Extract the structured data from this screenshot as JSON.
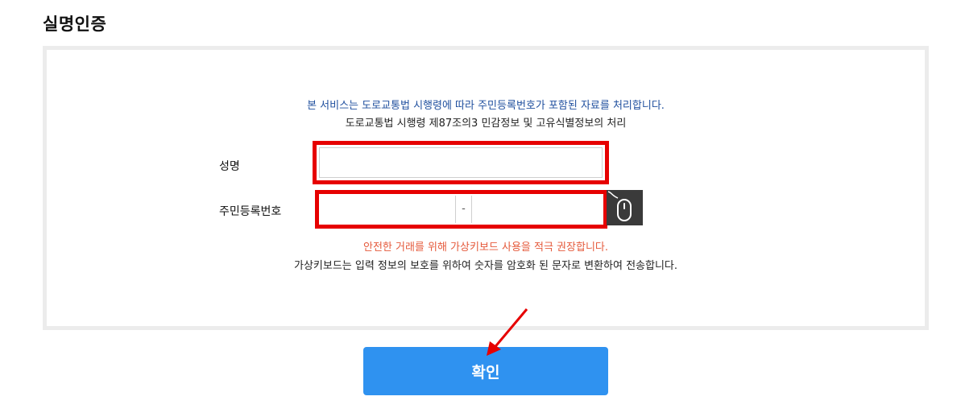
{
  "page": {
    "title": "실명인증"
  },
  "notice": {
    "line1": "본 서비스는 도로교통법 시행령에 따라 주민등록번호가 포함된 자료를 처리합니다.",
    "line2": "도로교통법 시행령 제87조의3 민감정보 및 고유식별정보의 처리"
  },
  "form": {
    "name_label": "성명",
    "name_value": "",
    "rrn_label": "주민등록번호",
    "rrn_front_value": "",
    "rrn_separator": "-",
    "rrn_back_value": ""
  },
  "virtual_keyboard": {
    "icon": "mouse-icon"
  },
  "warning": {
    "line1": "안전한 거래를 위해 가상키보드 사용을 적극 권장합니다.",
    "line2": "가상키보드는 입력 정보의 보호를 위하여 숫자를 암호화 된 문자로 변환하여 전송합니다."
  },
  "confirm": {
    "label": "확인"
  },
  "colors": {
    "notice_blue": "#1f4f9e",
    "warning_orange": "#e55a3c",
    "highlight_red": "#e60000",
    "button_blue": "#2f92f0"
  }
}
